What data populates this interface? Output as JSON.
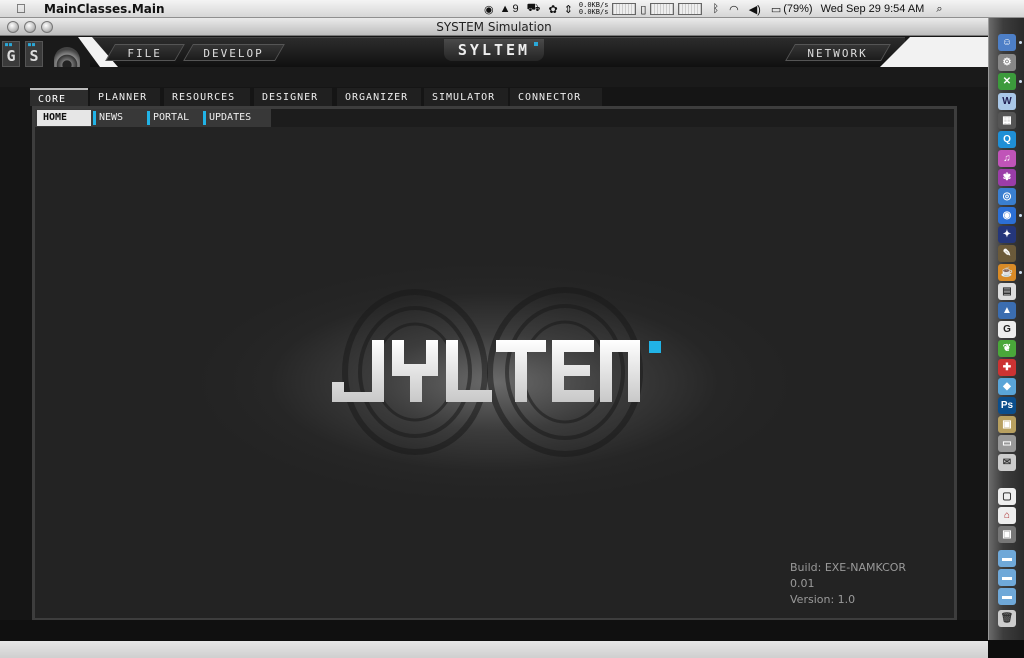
{
  "menubar": {
    "apple_icon": "apple-logo-icon",
    "app_name": "MainClasses.Main",
    "adobe_count": "9",
    "net_up": "0.0KB/s",
    "net_down": "0.0KB/s",
    "battery": "(79%)",
    "datetime": "Wed Sep 29  9:54 AM"
  },
  "window": {
    "title": "SYSTEM Simulation"
  },
  "header": {
    "g_label": "G",
    "s_label": "S",
    "logo_text": "SYLTEM",
    "file_label": "FILE",
    "develop_label": "DEVELOP",
    "network_label": "NETWORK"
  },
  "module_tabs": [
    {
      "label": "CORE",
      "active": true
    },
    {
      "label": "PLANNER"
    },
    {
      "label": "RESOURCES"
    },
    {
      "label": "DESIGNER"
    },
    {
      "label": "ORGANIZER"
    },
    {
      "label": "SIMULATOR"
    },
    {
      "label": "CONNECTOR"
    }
  ],
  "sub_tabs": [
    {
      "label": "HOME",
      "active": true
    },
    {
      "label": "NEWS"
    },
    {
      "label": "PORTAL"
    },
    {
      "label": "UPDATES"
    }
  ],
  "main": {
    "logo_text": "SYLTEM",
    "build": "Build: EXE-NAMKCOR  0.01",
    "version": "Version: 1.0"
  },
  "colors": {
    "accent": "#21b3e6",
    "background": "#242424"
  }
}
